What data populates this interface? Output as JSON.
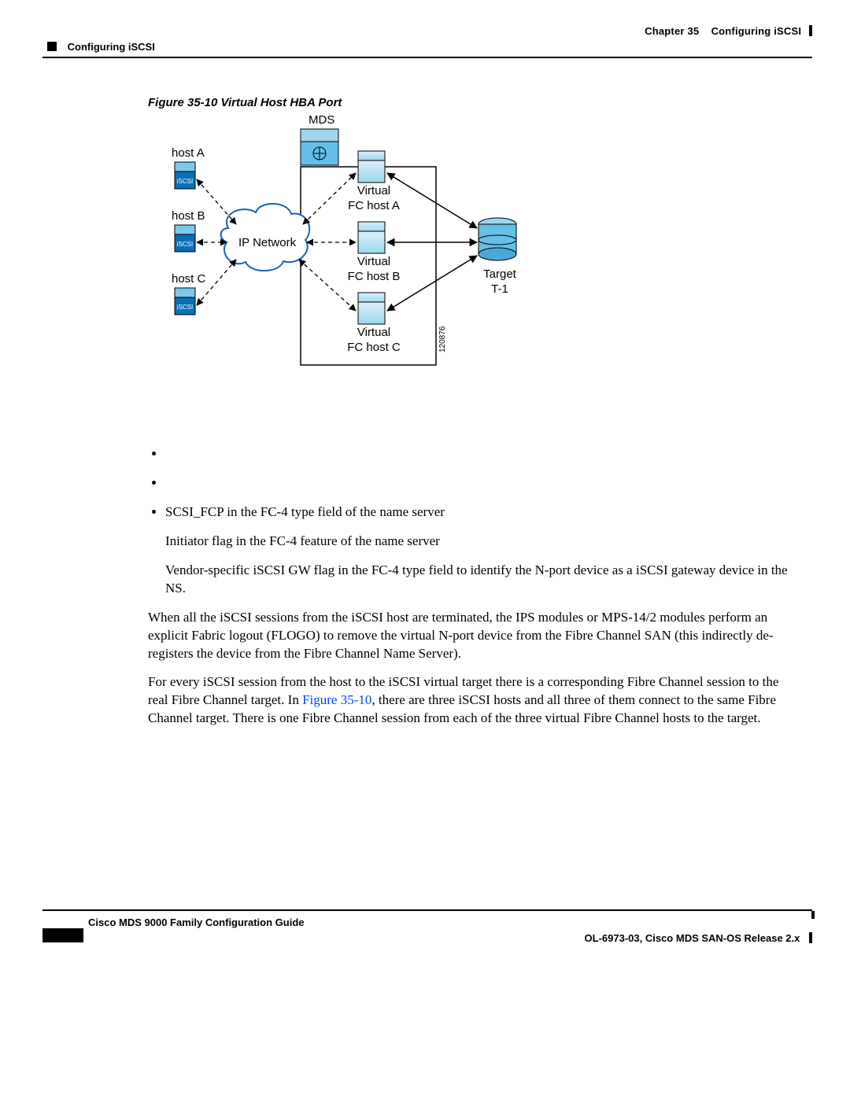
{
  "header": {
    "chapter_label": "Chapter 35",
    "chapter_title": "Configuring iSCSI",
    "section_left": "Configuring iSCSI"
  },
  "figure": {
    "caption": "Figure 35-10 Virtual Host HBA Port",
    "labels": {
      "mds": "MDS",
      "host_a": "host A",
      "host_b": "host B",
      "host_c": "host C",
      "ip_network": "IP Network",
      "virtual_a_l1": "Virtual",
      "virtual_a_l2": "FC host A",
      "virtual_b_l1": "Virtual",
      "virtual_b_l2": "FC host B",
      "virtual_c_l1": "Virtual",
      "virtual_c_l2": "FC host C",
      "target_l1": "Target",
      "target_l2": "T-1",
      "art_id": "120876",
      "iscsi": "iSCSI"
    }
  },
  "bullets": {
    "b1": "",
    "b2": "",
    "b3": "SCSI_FCP in the FC-4 type field of the name server",
    "b3_sub1": "Initiator flag in the FC-4 feature of the name server",
    "b3_sub2": "Vendor-specific iSCSI GW flag in the FC-4 type field to identify the N-port device as a iSCSI gateway device in the NS."
  },
  "paragraphs": {
    "p1": "When all the iSCSI sessions from the iSCSI host are terminated, the IPS modules or MPS-14/2 modules perform an explicit Fabric logout (FLOGO) to remove the virtual N-port device from the Fibre Channel SAN (this indirectly de-registers the device from the Fibre Channel Name Server).",
    "p2_a": "For every iSCSI session from the host to the iSCSI virtual target there is a corresponding Fibre Channel session to the real Fibre Channel target. In ",
    "p2_link": "Figure 35-10",
    "p2_b": ", there are three iSCSI hosts and all three of them connect to the same Fibre Channel target. There is one Fibre Channel session from each of the three virtual Fibre Channel hosts to the target."
  },
  "footer": {
    "book": "Cisco MDS 9000 Family Configuration Guide",
    "release": "OL-6973-03, Cisco MDS SAN-OS Release 2.x"
  }
}
